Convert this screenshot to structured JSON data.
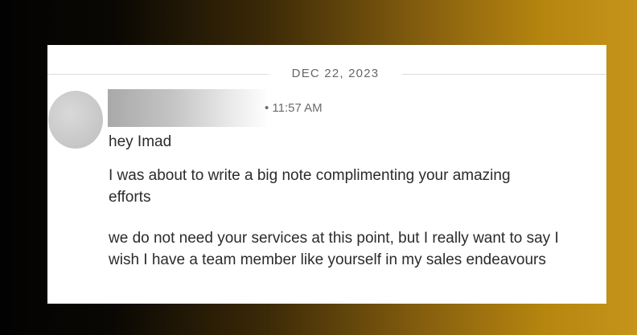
{
  "conversation": {
    "date_label": "DEC 22, 2023",
    "timestamp": "• 11:57 AM",
    "messages": [
      "hey Imad",
      "I was about to write a big note complimenting your amazing efforts",
      "we do not need your services at this point, but I really want to say I wish I have a team member like yourself in my sales endeavours"
    ]
  }
}
